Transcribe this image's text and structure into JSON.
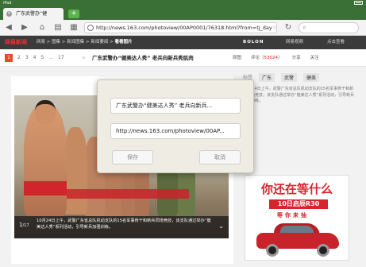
{
  "status": {
    "carrier": "iPad",
    "time": "",
    "battery_level": 0.8
  },
  "browser": {
    "tab_title": "广东武警办“健",
    "new_tab_label": "+",
    "url": "http://news.163.com/photoview/00AP0001/76318.html?from=tj_day",
    "nav_icons": [
      "back-icon",
      "forward-icon",
      "home-icon",
      "bookmarks-icon",
      "tabs-icon"
    ]
  },
  "site": {
    "logo": "网易新闻",
    "breadcrumbs": [
      "网易",
      "图集",
      "新闻图集",
      "新闻要闻"
    ],
    "active_crumb": "看看图片",
    "brand": "BOLON",
    "link_1": "网易视频",
    "link_2": "点击查看"
  },
  "article": {
    "pager": {
      "current": "1",
      "pages": [
        "2",
        "3",
        "4",
        "5",
        "...",
        "17"
      ]
    },
    "title": "广东武警办“健美达人秀” 老兵向新兵秀肌肉",
    "tools": {
      "gallery": "原图",
      "comments_label": "评论",
      "comments_count": "53024",
      "share": "分享",
      "follow": "关注"
    }
  },
  "photo_caption": {
    "current": "1",
    "total": "17",
    "text": "10月24日上午，武警广东省总队机动支队的15名军事骨干和新兵同场竞技，该支队通过举办“健美达人秀”系列活动，引导新兵加强训练。"
  },
  "sidebar": {
    "tags_label": "标签",
    "tags": [
      "广东",
      "武警",
      "健美"
    ],
    "desc": "10月24日上午，武警广东省总队机动支队的15名军事骨干和新兵同场竞技，该支队通过举办“健美达人秀”系列活动，引导新兵加强训练。"
  },
  "ad": {
    "headline": "你还在等什么",
    "model": "10日启辰R30",
    "cta": "等你来抽"
  },
  "modal": {
    "title_field": "广东武警办“健美达人秀” 老兵向新兵...",
    "url_field": "http://news.163.com/photoview/00AP...",
    "save_label": "保存",
    "cancel_label": "取消"
  },
  "colors": {
    "accent_green": "#3a6f35",
    "netease_red": "#d8242c"
  }
}
